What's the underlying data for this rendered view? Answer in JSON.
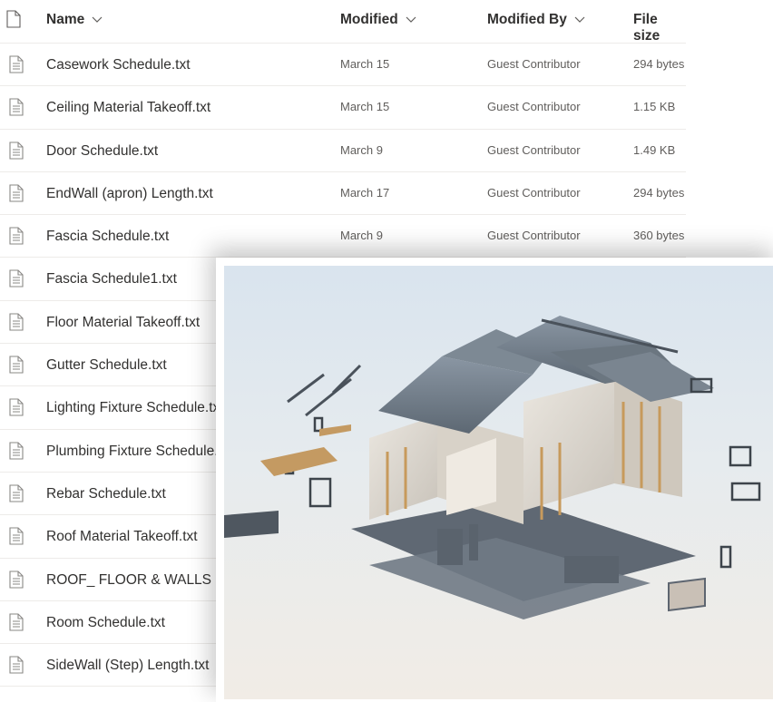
{
  "headers": {
    "name": "Name",
    "modified": "Modified",
    "modified_by": "Modified By",
    "file_size": "File size"
  },
  "rows": [
    {
      "name": "Casework Schedule.txt",
      "modified": "March 15",
      "by": "Guest Contributor",
      "size": "294 bytes"
    },
    {
      "name": "Ceiling Material Takeoff.txt",
      "modified": "March 15",
      "by": "Guest Contributor",
      "size": "1.15 KB"
    },
    {
      "name": "Door Schedule.txt",
      "modified": "March 9",
      "by": "Guest Contributor",
      "size": "1.49 KB"
    },
    {
      "name": "EndWall (apron) Length.txt",
      "modified": "March 17",
      "by": "Guest Contributor",
      "size": "294 bytes"
    },
    {
      "name": "Fascia Schedule.txt",
      "modified": "March 9",
      "by": "Guest Contributor",
      "size": "360 bytes"
    },
    {
      "name": "Fascia Schedule1.txt",
      "modified": "",
      "by": "",
      "size": ""
    },
    {
      "name": "Floor Material Takeoff.txt",
      "modified": "",
      "by": "",
      "size": ""
    },
    {
      "name": "Gutter Schedule.txt",
      "modified": "",
      "by": "",
      "size": ""
    },
    {
      "name": "Lighting Fixture Schedule.txt",
      "modified": "",
      "by": "",
      "size": ""
    },
    {
      "name": "Plumbing Fixture Schedule.txt",
      "modified": "",
      "by": "",
      "size": ""
    },
    {
      "name": "Rebar Schedule.txt",
      "modified": "",
      "by": "",
      "size": ""
    },
    {
      "name": "Roof Material Takeoff.txt",
      "modified": "",
      "by": "",
      "size": ""
    },
    {
      "name": "ROOF_ FLOOR & WALLS -PA",
      "modified": "",
      "by": "",
      "size": ""
    },
    {
      "name": "Room Schedule.txt",
      "modified": "",
      "by": "",
      "size": ""
    },
    {
      "name": "SideWall (Step) Length.txt",
      "modified": "",
      "by": "",
      "size": ""
    }
  ],
  "icons": {
    "header": "document-icon",
    "row": "text-file-icon",
    "sort": "chevron-down-icon"
  },
  "colors": {
    "divider": "#edebe9",
    "text_primary": "#323130",
    "text_secondary": "#605e5c"
  },
  "overlay_image": "exploded-house-3d-model"
}
